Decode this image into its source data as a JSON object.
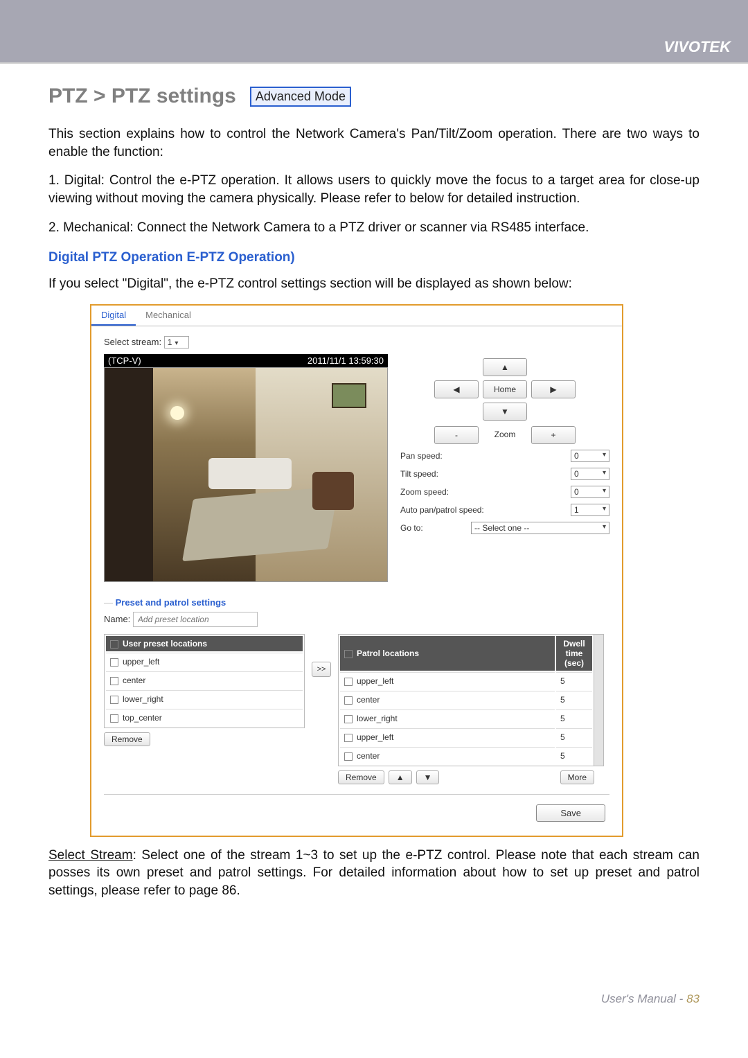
{
  "brand": "VIVOTEK",
  "breadcrumb": "PTZ > PTZ settings",
  "advanced_badge": "Advanced Mode",
  "intro1": "This section explains how to control the Network Camera's Pan/Tilt/Zoom operation. There are two ways to enable the function:",
  "intro_item1": "1. Digital: Control the e-PTZ operation. It allows users to quickly move the focus to a target area for close-up viewing without moving the camera physically. Please refer to below for detailed instruction.",
  "intro_item2": "2. Mechanical: Connect the Network Camera to a PTZ driver or scanner via RS485 interface.",
  "subheading": "Digital PTZ Operation E-PTZ Operation)",
  "intro2": "If you select \"Digital\", the e-PTZ control settings section will be displayed as shown below:",
  "panel": {
    "tabs": {
      "digital": "Digital",
      "mechanical": "Mechanical"
    },
    "stream_label": "Select stream:",
    "stream_value": "1",
    "video_name": "(TCP-V)",
    "video_ts": "2011/11/1 13:59:30",
    "controls": {
      "up": "▲",
      "down": "▼",
      "left": "◀",
      "right": "▶",
      "home": "Home",
      "zoom_label": "Zoom",
      "minus": "-",
      "plus": "+"
    },
    "speeds": {
      "pan_label": "Pan speed:",
      "pan_val": "0",
      "tilt_label": "Tilt speed:",
      "tilt_val": "0",
      "zoom_label": "Zoom speed:",
      "zoom_val": "0",
      "auto_label": "Auto pan/patrol speed:",
      "auto_val": "1",
      "goto_label": "Go to:",
      "goto_val": "-- Select one --"
    },
    "preset_title": "Preset and patrol settings",
    "name_label": "Name:",
    "name_placeholder": "Add preset location",
    "user_header": "User preset locations",
    "user_items": [
      "upper_left",
      "center",
      "lower_right",
      "top_center"
    ],
    "patrol_header": "Patrol locations",
    "dwell_header1": "Dwell time",
    "dwell_header2": "(sec)",
    "patrol_items": [
      {
        "name": "upper_left",
        "dwell": "5"
      },
      {
        "name": "center",
        "dwell": "5"
      },
      {
        "name": "lower_right",
        "dwell": "5"
      },
      {
        "name": "upper_left",
        "dwell": "5"
      },
      {
        "name": "center",
        "dwell": "5"
      }
    ],
    "transfer_btn": ">>",
    "remove_btn": "Remove",
    "up_btn": "▲",
    "down_btn": "▼",
    "more_btn": "More",
    "save_btn": "Save"
  },
  "after": {
    "label": "Select Stream",
    "text": ": Select one of the stream 1~3 to set up the e-PTZ control. Please note that each stream can posses its own preset and patrol settings. For detailed information about how to set up preset and patrol settings, please refer to page 86."
  },
  "footer": {
    "label": "User's Manual - ",
    "page": "83"
  }
}
